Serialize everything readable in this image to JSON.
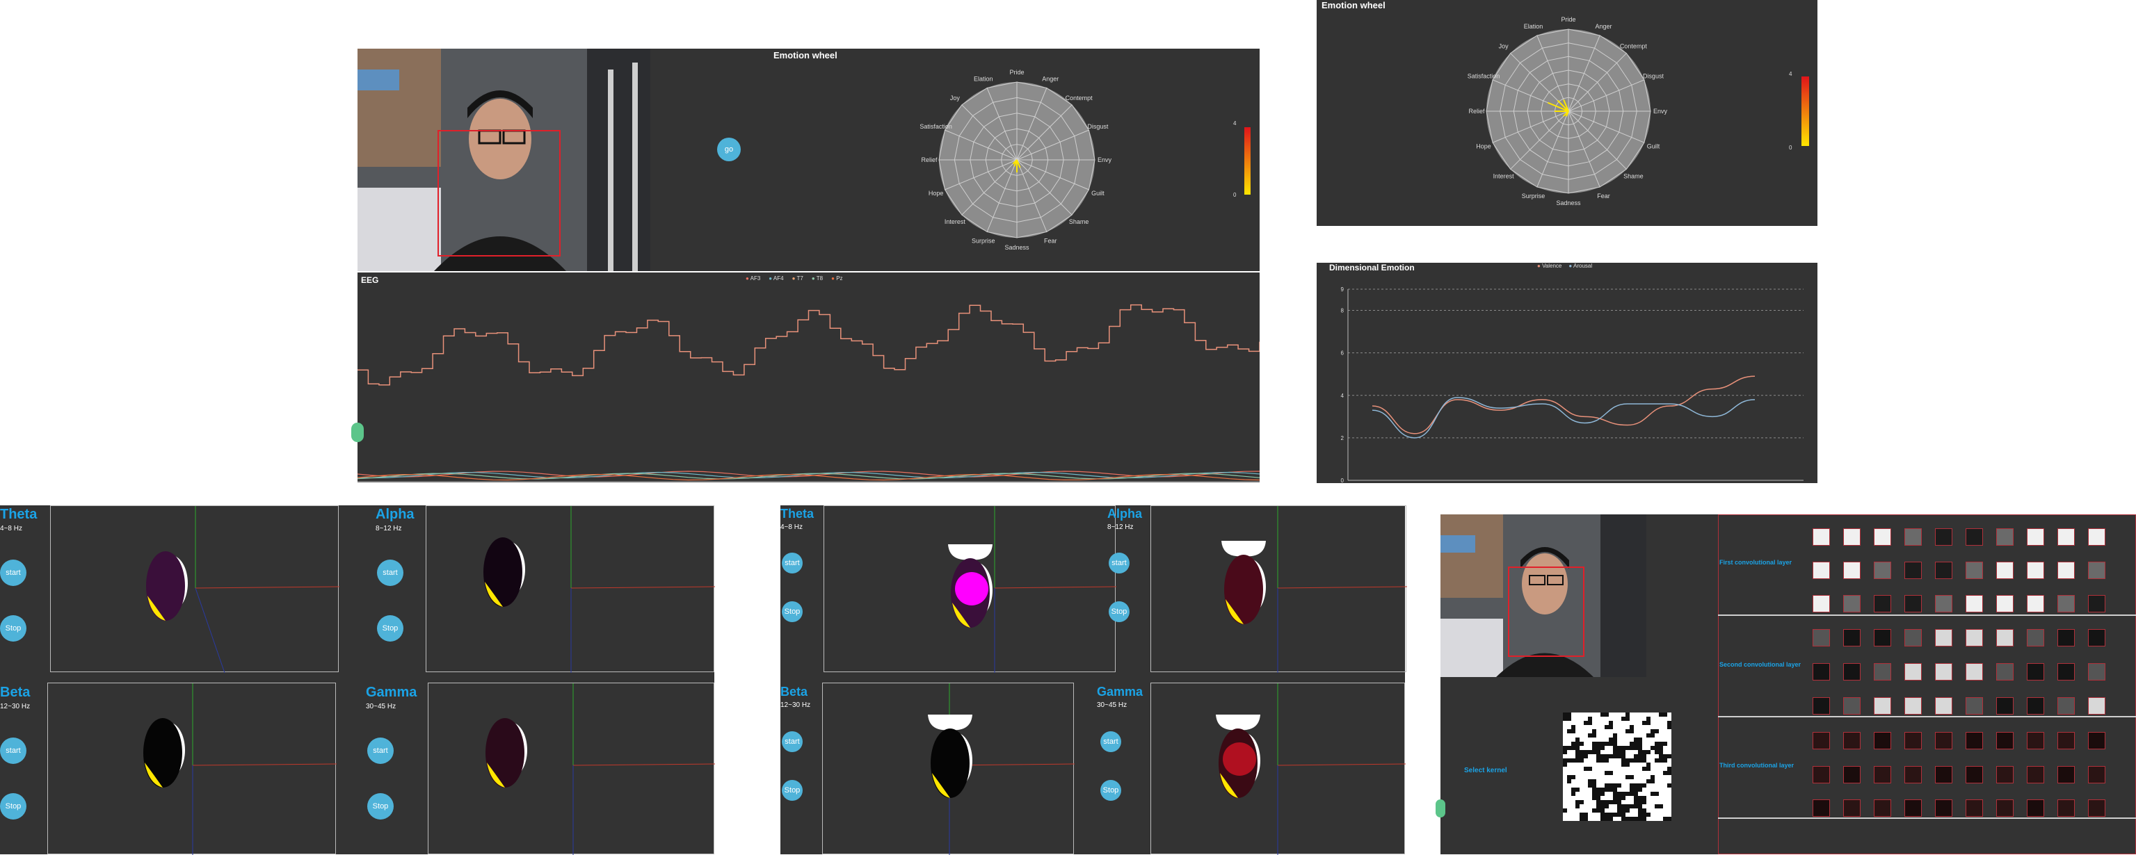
{
  "emotion_wheel": {
    "title": "Emotion wheel",
    "emotions": [
      "Pride",
      "Anger",
      "Contempt",
      "Disgust",
      "Envy",
      "Guilt",
      "Shame",
      "Fear",
      "Sadness",
      "Surprise",
      "Interest",
      "Hope",
      "Relief",
      "Satisfaction",
      "Joy",
      "Elation"
    ],
    "scale_max": "4",
    "scale_min": "0"
  },
  "left_app": {
    "go_button": "go",
    "eeg_title": "EEG",
    "eeg_legend": [
      "AF3",
      "AF4",
      "T7",
      "T8",
      "Pz"
    ]
  },
  "dimensional": {
    "title": "Dimensional Emotion",
    "legend": [
      "Valence",
      "Arousal"
    ],
    "y_ticks": [
      "9",
      "8",
      "6",
      "4",
      "2",
      "0"
    ]
  },
  "bands": [
    {
      "name": "Theta",
      "range": "4~8 Hz"
    },
    {
      "name": "Alpha",
      "range": "8~12 Hz"
    },
    {
      "name": "Beta",
      "range": "12~30 Hz"
    },
    {
      "name": "Gamma",
      "range": "30~45 Hz"
    }
  ],
  "buttons": {
    "start": "start",
    "stop": "Stop"
  },
  "cnn": {
    "layers": [
      "First convolutional layer",
      "Second convolutional layer",
      "Third convolutional layer"
    ],
    "select_kernel": "Select kernel"
  },
  "colors": {
    "panel_bg": "#333333",
    "accent_blue": "#1ba3e6",
    "button_blue": "#4fb3d9",
    "eeg_line": "#e8917a",
    "valence": "#e8917a",
    "arousal": "#8fb8d8",
    "face_box": "#e0202a"
  },
  "chart_data": [
    {
      "type": "line",
      "title": "Dimensional Emotion",
      "series": [
        {
          "name": "Valence",
          "values": [
            3.5,
            2.2,
            3.8,
            3.3,
            3.8,
            3.0,
            2.6,
            3.5,
            4.3,
            4.9
          ]
        },
        {
          "name": "Arousal",
          "values": [
            3.3,
            2.0,
            3.9,
            3.4,
            3.6,
            2.7,
            3.6,
            3.6,
            3.0,
            3.8
          ]
        }
      ],
      "ylim": [
        0,
        9
      ]
    }
  ]
}
